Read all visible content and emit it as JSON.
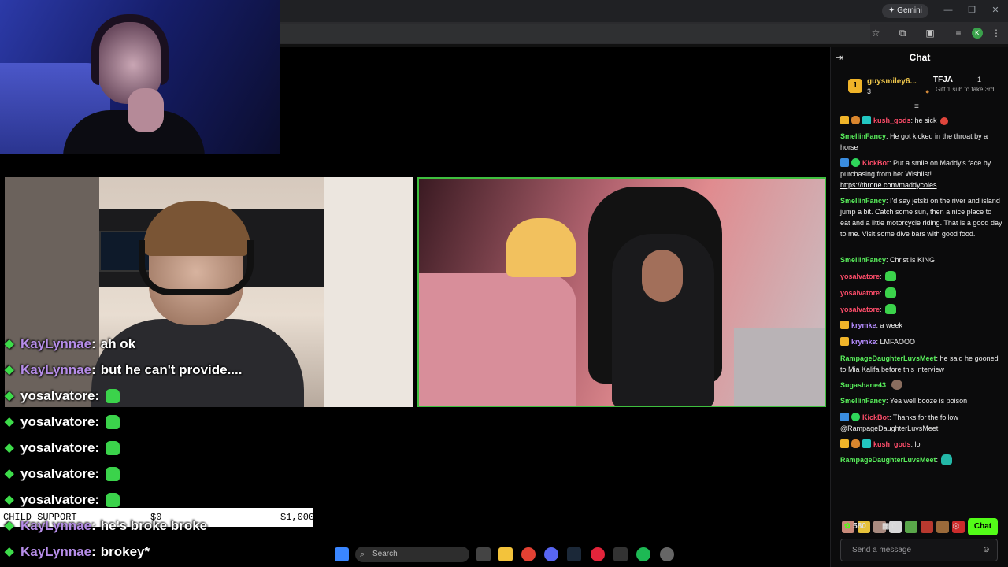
{
  "browser": {
    "gemini_label": "Gemini",
    "profile_initial": "K"
  },
  "stream_overlay": {
    "lines": [
      {
        "user": "KayLynnae",
        "msg": "ah ok",
        "emote": false
      },
      {
        "user": "KayLynnae",
        "msg": "but he can't provide....",
        "emote": false
      },
      {
        "user": "yosalvatore",
        "msg": "",
        "emote": true
      },
      {
        "user": "yosalvatore",
        "msg": "",
        "emote": true
      },
      {
        "user": "yosalvatore",
        "msg": "",
        "emote": true
      },
      {
        "user": "yosalvatore",
        "msg": "",
        "emote": true
      },
      {
        "user": "yosalvatore",
        "msg": "",
        "emote": true
      },
      {
        "user": "KayLynnae",
        "msg": "he's broke broke",
        "emote": false
      },
      {
        "user": "KayLynnae",
        "msg": "brokey*",
        "emote": false
      }
    ],
    "child_support": {
      "label": "CHILD SUPPORT",
      "current": "$0",
      "goal": "$1,000"
    }
  },
  "taskbar": {
    "search_placeholder": "Search"
  },
  "chat": {
    "title": "Chat",
    "leaderboard": {
      "first": {
        "rank": "1",
        "name": "guysmiley6...",
        "count": "3"
      },
      "second": {
        "name": "TFJA",
        "count": "1",
        "gift_text": "Gift 1 sub to take 3rd"
      }
    },
    "messages": {
      "m1": {
        "user": "kush_gods",
        "text": ": he sick"
      },
      "m2": {
        "user": "SmellinFancy",
        "text": ": He got kicked in the throat by a horse"
      },
      "m3": {
        "user": "KickBot",
        "text": ": Put a smile on Maddy's face by purchasing from her Wishlist! ",
        "link": "https://throne.com/maddycoles"
      },
      "m4": {
        "user": "SmellinFancy",
        "text": ": I'd say jetski on the river and island jump a bit. Catch some sun, then a nice place to eat and a little motorcycle riding. That is a good day to me. Visit some dive bars with good food."
      },
      "m5": {
        "user": "SmellinFancy",
        "text": ": Christ is KING"
      },
      "m6": {
        "user": "yosalvatore",
        "text": ":"
      },
      "m7": {
        "user": "yosalvatore",
        "text": ":"
      },
      "m8": {
        "user": "yosalvatore",
        "text": ":"
      },
      "m9": {
        "user": "krymke",
        "text": ": a week"
      },
      "m10": {
        "user": "krymke",
        "text": ": LMFAOOO"
      },
      "m11": {
        "user": "RampageDaughterLuvsMeet",
        "text": ": he said he gooned to Mia Kalifa before this interview"
      },
      "m12": {
        "user": "Sugashane43",
        "text": ":"
      },
      "m13": {
        "user": "SmellinFancy",
        "text": ": Yea well booze is poison"
      },
      "m14": {
        "user": "KickBot",
        "text": ": Thanks for the follow @RampageDaughterLuvsMeet"
      },
      "m15": {
        "user": "kush_gods",
        "text": ": lol"
      },
      "m16": {
        "user": "RampageDaughterLuvsMeet",
        "text": ":"
      }
    },
    "input_placeholder": "Send a message",
    "points": "580",
    "drops": "0",
    "send_label": "Chat"
  },
  "colors": {
    "kick_green": "#53fc18",
    "panel_border": "#3fbf3f"
  }
}
